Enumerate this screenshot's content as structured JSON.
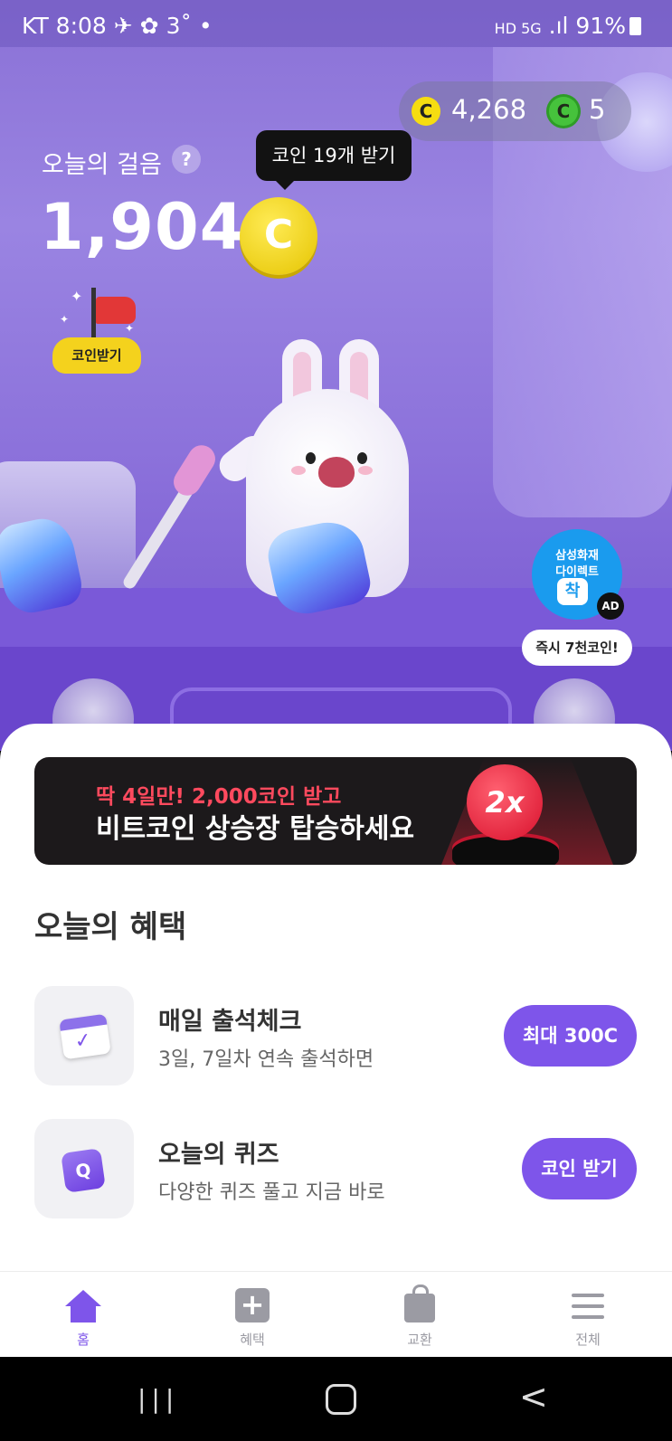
{
  "status_bar": {
    "carrier_time": "KT 8:08",
    "temp": "3˚",
    "dot": "•",
    "network": "HD 5G",
    "signal": ".ıl",
    "battery": "91%"
  },
  "wallet": {
    "coins": "4,268",
    "coin_symbol": "C",
    "green_coins": "5"
  },
  "steps": {
    "label": "오늘의 걸음",
    "help": "?",
    "count": "1,904",
    "coin_symbol": "C",
    "tooltip": "코인 19개 받기"
  },
  "claim_badge": {
    "label": "코인받기"
  },
  "ad": {
    "line1": "삼성화재",
    "line2": "다이렉트",
    "badge": "착",
    "tag": "AD",
    "pill": "즉시 7천코인!"
  },
  "banner": {
    "line1": "딱 4일만! 2,000코인 받고",
    "line2": "비트코인 상승장 탑승하세요",
    "badge": "2x"
  },
  "benefits": {
    "title": "오늘의 혜택",
    "items": [
      {
        "title": "매일 출석체크",
        "subtitle": "3일, 7일차 연속 출석하면",
        "button": "최대 300C",
        "icon": "calendar-check-icon"
      },
      {
        "title": "오늘의 퀴즈",
        "subtitle": "다양한 퀴즈 풀고 지금 바로",
        "button": "코인 받기",
        "icon": "quiz-q-icon"
      }
    ]
  },
  "tabs": [
    {
      "label": "홈",
      "icon": "home-icon",
      "active": true
    },
    {
      "label": "혜택",
      "icon": "plus-box-icon",
      "active": false
    },
    {
      "label": "교환",
      "icon": "shopping-bag-icon",
      "active": false
    },
    {
      "label": "전체",
      "icon": "menu-icon",
      "active": false
    }
  ],
  "system_nav": {
    "recent": "|||",
    "back": "<"
  },
  "colors": {
    "accent": "#7e55ea",
    "coin": "#f6dd11",
    "banner_bg": "#1c191b",
    "banner_highlight": "#ff4a5e"
  }
}
